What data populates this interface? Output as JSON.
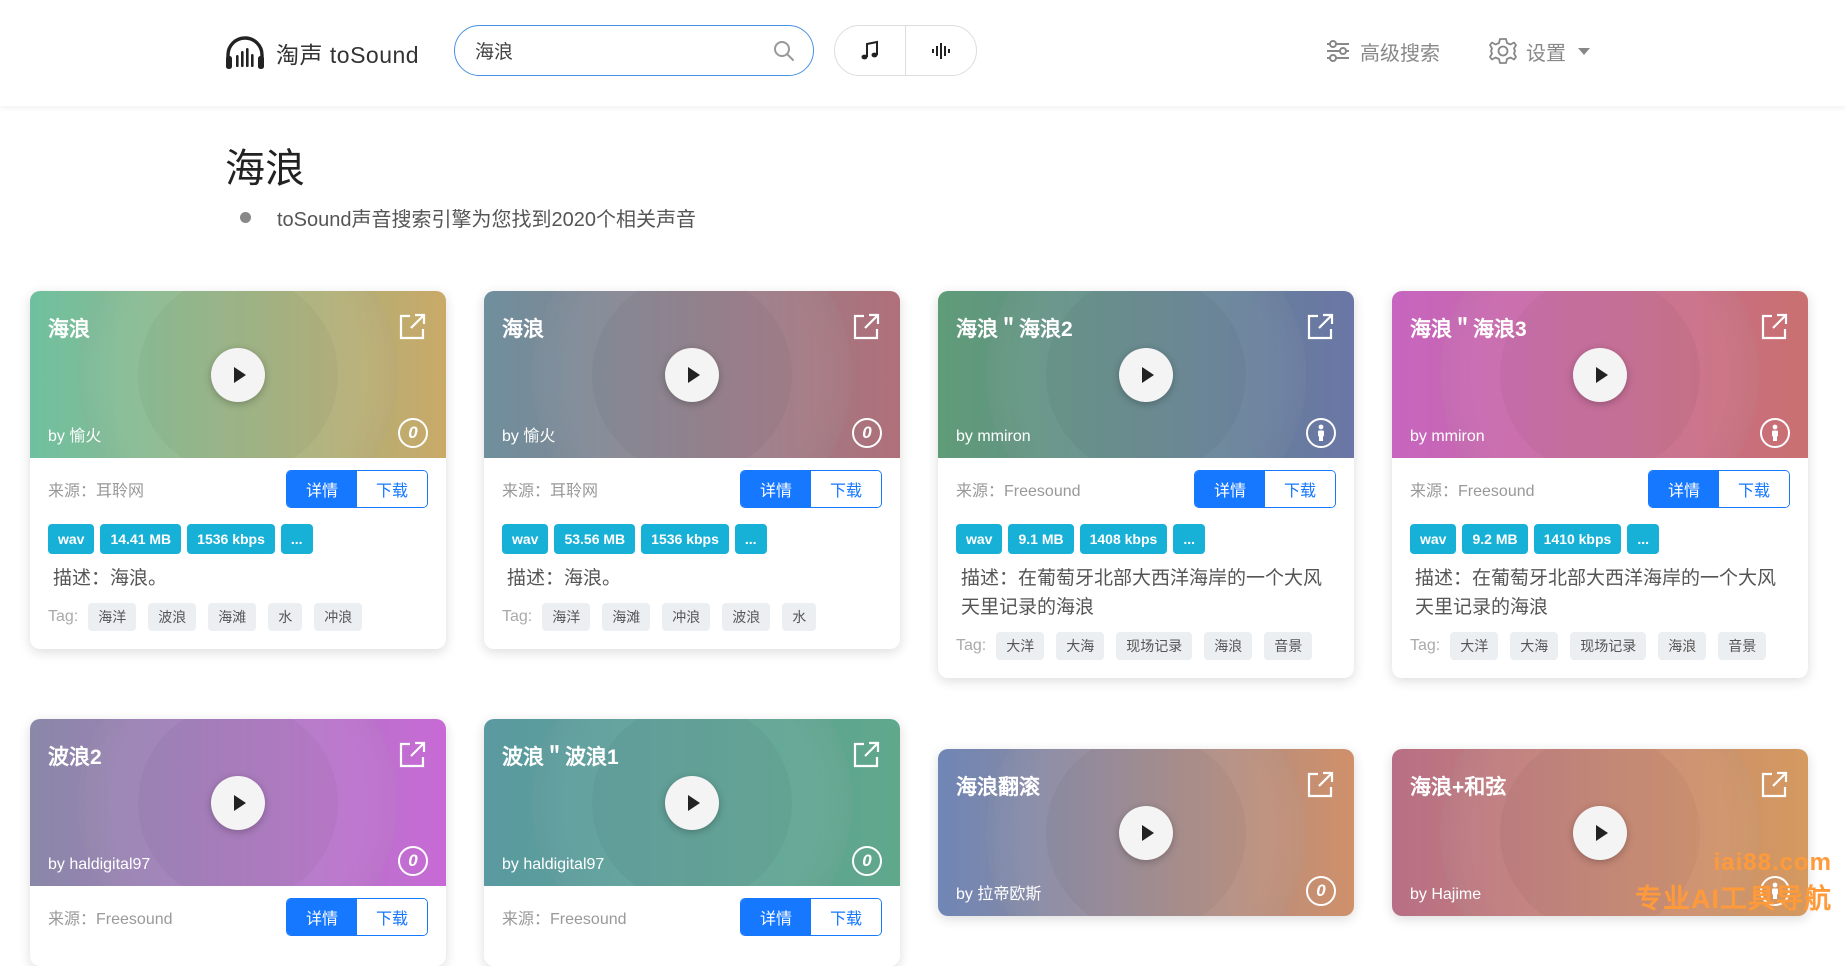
{
  "header": {
    "brand": "淘声 toSound",
    "search_value": "海浪",
    "advanced_search": "高级搜索",
    "settings": "设置"
  },
  "page": {
    "title": "海浪",
    "result_text": "toSound声音搜索引擎为您找到2020个相关声音"
  },
  "labels": {
    "source_prefix": "来源：",
    "detail": "详情",
    "download": "下载",
    "tag_label": "Tag:"
  },
  "cards": [
    {
      "title": "海浪",
      "author": "by 愉火",
      "license": "zero",
      "source": "耳聆网",
      "format": "wav",
      "size": "14.41 MB",
      "bitrate": "1536 kbps",
      "more": "...",
      "desc": "描述：海浪。",
      "tags": [
        "海洋",
        "波浪",
        "海滩",
        "水",
        "冲浪"
      ],
      "color_a": "#6fc0a0",
      "color_b": "#c9a968"
    },
    {
      "title": "海浪",
      "author": "by 愉火",
      "license": "zero",
      "source": "耳聆网",
      "format": "wav",
      "size": "53.56 MB",
      "bitrate": "1536 kbps",
      "more": "...",
      "desc": "描述：海浪。",
      "tags": [
        "海洋",
        "海滩",
        "冲浪",
        "波浪",
        "水"
      ],
      "color_a": "#6f8f9d",
      "color_b": "#b0707a"
    },
    {
      "title": "海浪＂海浪2",
      "author": "by mmiron",
      "license": "by",
      "source": "Freesound",
      "format": "wav",
      "size": "9.1 MB",
      "bitrate": "1408 kbps",
      "more": "...",
      "desc": "描述：在葡萄牙北部大西洋海岸的一个大风天里记录的海浪",
      "tags": [
        "大洋",
        "大海",
        "现场记录",
        "海浪",
        "音景"
      ],
      "color_a": "#5f9c78",
      "color_b": "#6a76a6"
    },
    {
      "title": "海浪＂海浪3",
      "author": "by mmiron",
      "license": "by",
      "source": "Freesound",
      "format": "wav",
      "size": "9.2 MB",
      "bitrate": "1410 kbps",
      "more": "...",
      "desc": "描述：在葡萄牙北部大西洋海岸的一个大风天里记录的海浪",
      "tags": [
        "大洋",
        "大海",
        "现场记录",
        "海浪",
        "音景"
      ],
      "color_a": "#c765c0",
      "color_b": "#c97070"
    },
    {
      "title": "波浪2",
      "author": "by haldigital97",
      "license": "zero",
      "source": "Freesound",
      "color_a": "#8a88a8",
      "color_b": "#c86ad6"
    },
    {
      "title": "波浪＂波浪1",
      "author": "by haldigital97",
      "license": "zero",
      "source": "Freesound",
      "color_a": "#5a9aa0",
      "color_b": "#60a88c"
    },
    {
      "title": "海浪翻滚",
      "author": "by 拉帝欧斯",
      "license": "zero",
      "color_a": "#6f86b6",
      "color_b": "#d0906a"
    },
    {
      "title": "海浪+和弦",
      "author": "by Hajime",
      "license": "by",
      "color_a": "#b86f86",
      "color_b": "#d49a60"
    }
  ],
  "watermark": {
    "line1": "iai88.com",
    "line2": "专业AI工具导航"
  }
}
